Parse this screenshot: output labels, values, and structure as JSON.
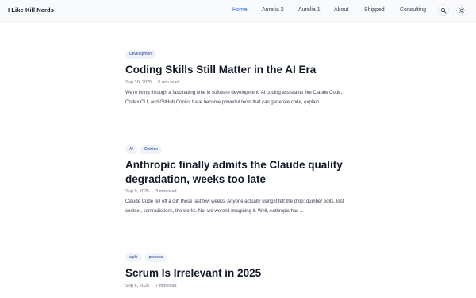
{
  "site": {
    "brand": "I Like Kill Nerds"
  },
  "nav": {
    "items": [
      {
        "label": "Home",
        "active": true
      },
      {
        "label": "Aurelia 2",
        "active": false
      },
      {
        "label": "Aurelia 1",
        "active": false
      },
      {
        "label": "About",
        "active": false
      },
      {
        "label": "Shipped",
        "active": false
      },
      {
        "label": "Consulting",
        "active": false
      }
    ],
    "search_icon": "search-icon",
    "theme_icon": "sun-icon"
  },
  "colors": {
    "accent": "#2563eb",
    "tag_bg": "#eff4fb",
    "header_bg": "#f9fafb"
  },
  "posts": [
    {
      "tags": [
        "Development"
      ],
      "title": "Coding Skills Still Matter in the AI Era",
      "date": "Sep 10, 2025",
      "read_time": "5 min read",
      "excerpt": "We're living through a fascinating time in software development. AI coding assistants like Claude Code, Codex CLI, and GitHub Copilot have become powerful tools that can generate code, explain ..."
    },
    {
      "tags": [
        "AI",
        "Opinion"
      ],
      "title": "Anthropic finally admits the Claude quality degradation, weeks too late",
      "date": "Sep 9, 2025",
      "read_time": "3 min read",
      "excerpt": "Claude Code fell off a cliff these last few weeks. Anyone actually using it felt the drop: dumber edits, lost context, contradictions, the works. No, we weren't imagining it. Well, Anthropic has ..."
    },
    {
      "tags": [
        "agile",
        "process"
      ],
      "title": "Scrum Is Irrelevant in 2025",
      "date": "Sep 6, 2025",
      "read_time": "7 min read",
      "excerpt": ""
    }
  ]
}
